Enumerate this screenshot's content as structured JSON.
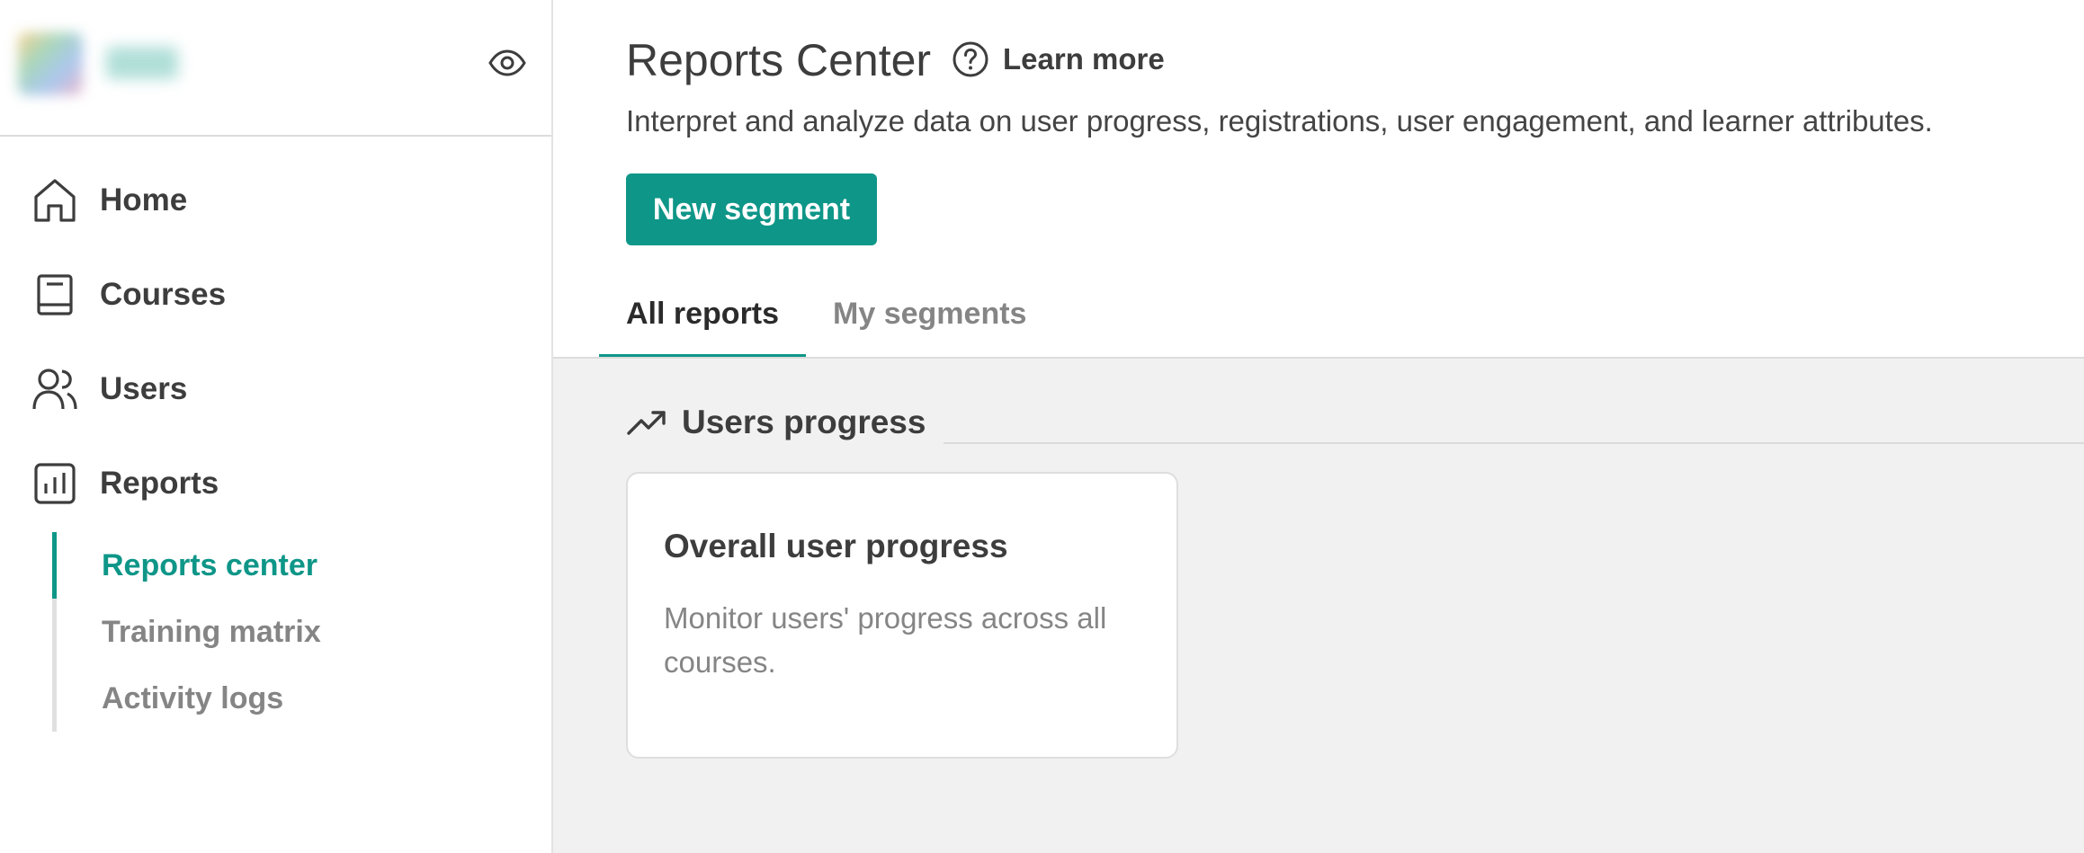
{
  "sidebar": {
    "nav": [
      {
        "label": "Home",
        "icon": "home-icon"
      },
      {
        "label": "Courses",
        "icon": "book-icon"
      },
      {
        "label": "Users",
        "icon": "users-icon"
      },
      {
        "label": "Reports",
        "icon": "bar-chart-icon"
      }
    ],
    "reports_sub": [
      {
        "label": "Reports center",
        "active": true
      },
      {
        "label": "Training matrix",
        "active": false
      },
      {
        "label": "Activity logs",
        "active": false
      }
    ]
  },
  "header": {
    "title": "Reports Center",
    "learn_more": "Learn more",
    "subtitle": "Interpret and analyze data on user progress, registrations, user engagement, and learner attributes.",
    "new_segment": "New segment"
  },
  "tabs": [
    {
      "label": "All reports",
      "active": true
    },
    {
      "label": "My segments",
      "active": false
    }
  ],
  "section": {
    "title": "Users progress",
    "icon": "trending-up-icon",
    "cards": [
      {
        "title": "Overall user progress",
        "description": "Monitor users' progress across all courses."
      }
    ]
  },
  "colors": {
    "accent": "#0e9688",
    "text": "#3d3d3d",
    "muted": "#858585",
    "content_bg": "#f1f1f1"
  }
}
